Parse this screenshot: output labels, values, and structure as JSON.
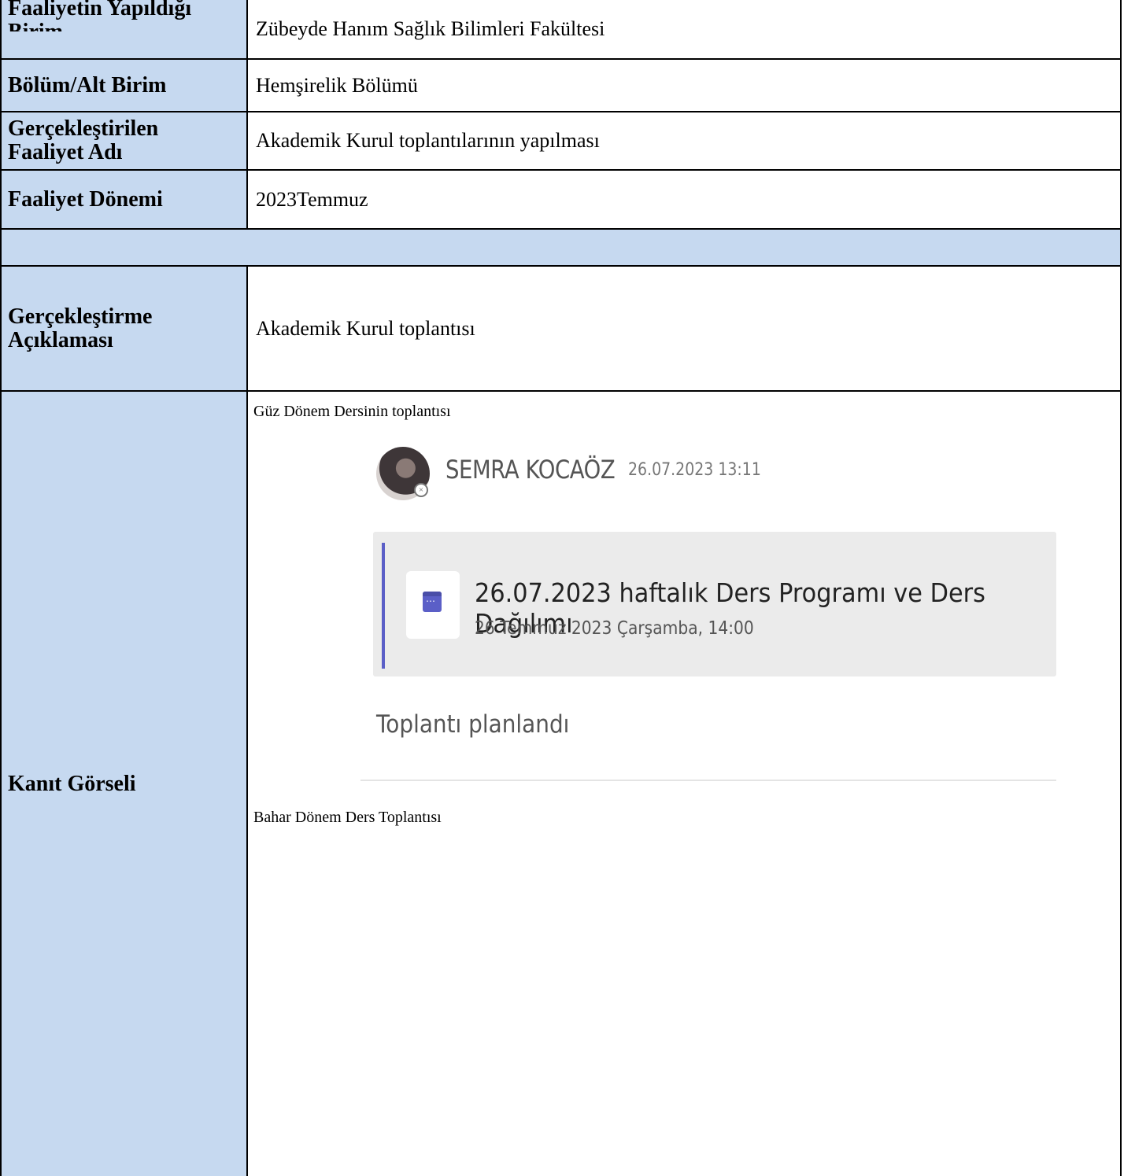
{
  "rows": {
    "unit": {
      "label": "Faaliyetin Yapıldığı Birim",
      "value": "Zübeyde Hanım Sağlık Bilimleri Fakültesi"
    },
    "department": {
      "label": "Bölüm/Alt Birim",
      "value": "Hemşirelik Bölümü"
    },
    "activity_name": {
      "label": "Gerçekleştirilen Faaliyet Adı",
      "value": "Akademik Kurul toplantılarının yapılması"
    },
    "period": {
      "label": "Faaliyet Dönemi",
      "value": "2023Temmuz"
    },
    "description": {
      "label": "Gerçekleştirme Açıklaması",
      "value": "Akademik Kurul toplantısı"
    },
    "evidence": {
      "label": "Kanıt Görseli"
    }
  },
  "evidence": {
    "caption_fall": "Güz Dönem Dersinin toplantısı",
    "caption_spring": "Bahar Dönem Ders Toplantısı",
    "screenshot": {
      "sender": "SEMRA KOCAÖZ",
      "sent_at": "26.07.2023 13:11",
      "meeting_title": "26.07.2023 haftalık Ders Programı ve Ders Dağılımı",
      "meeting_time": "26 Temmuz 2023 Çarşamba, 14:00",
      "status": "Toplantı planlandı",
      "icons": [
        "avatar",
        "calendar-icon"
      ]
    }
  },
  "colors": {
    "label_bg": "#c6d9f0",
    "border": "#000000",
    "teams_accent": "#5b5fc7"
  }
}
